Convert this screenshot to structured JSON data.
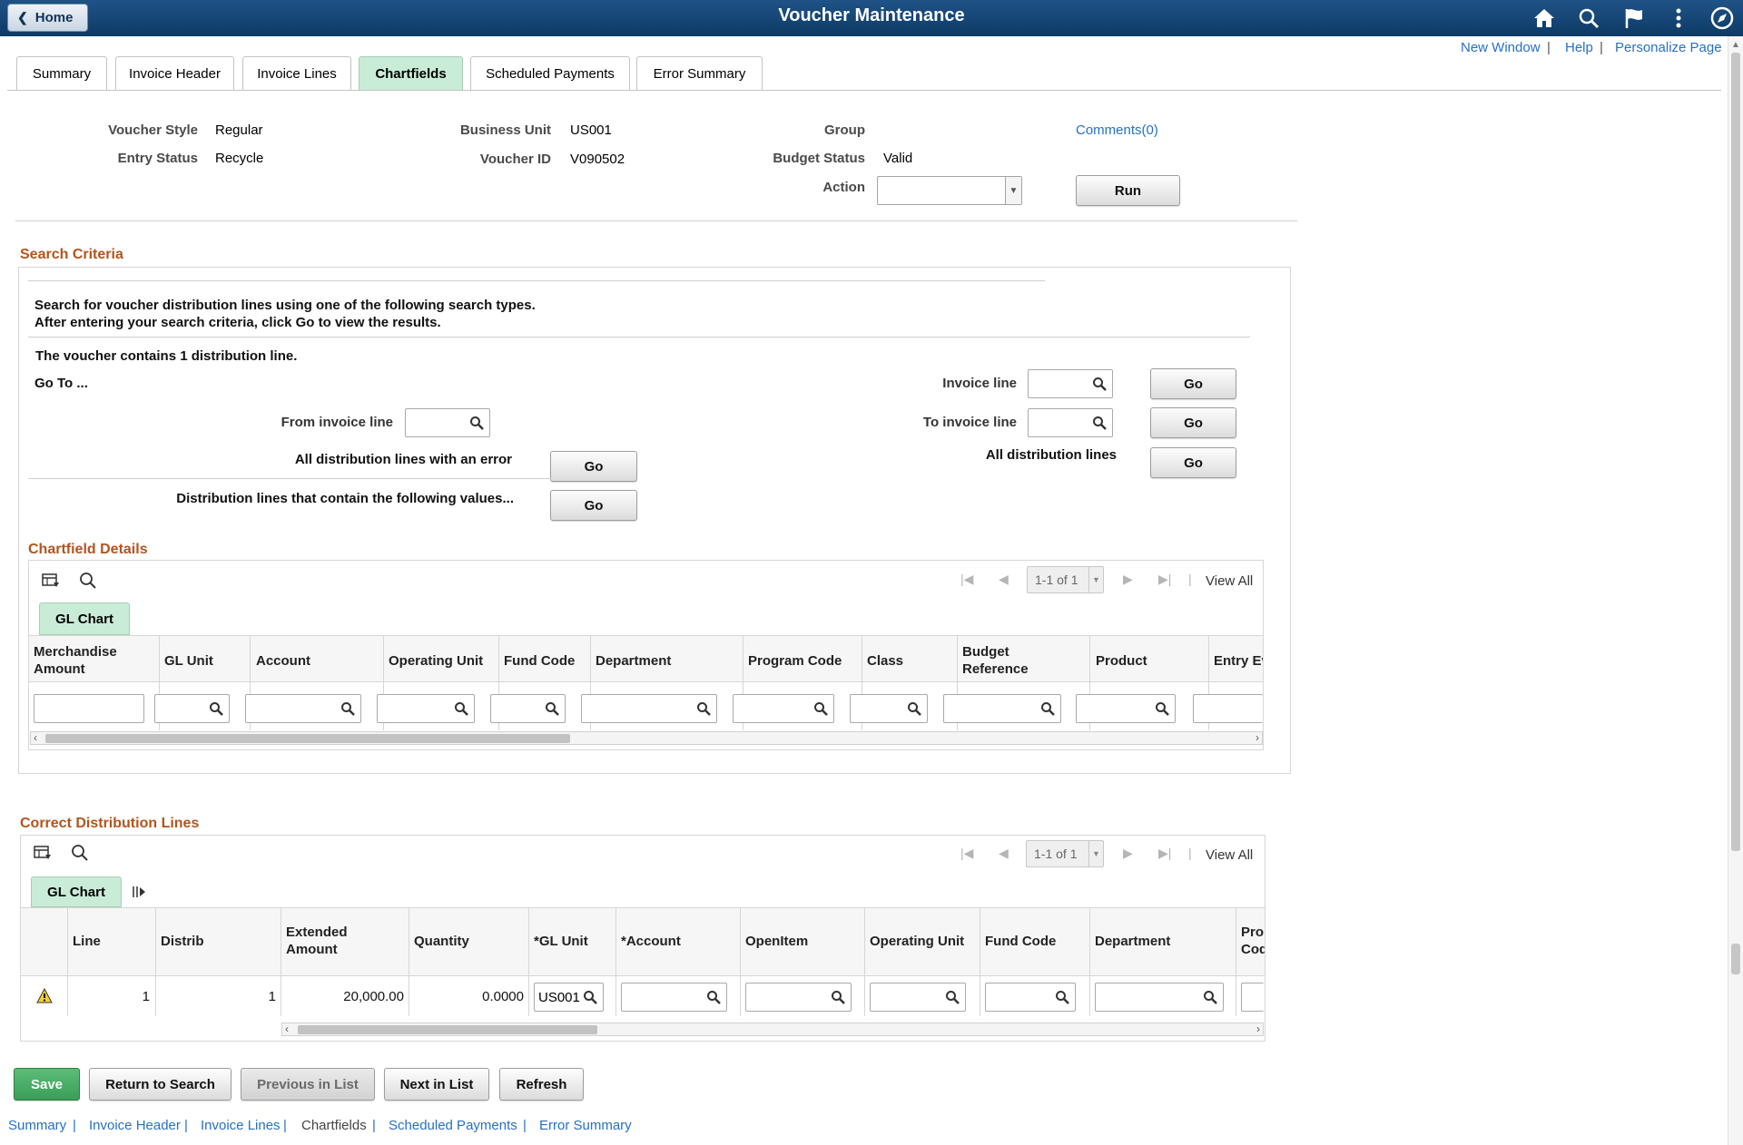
{
  "banner": {
    "home_label": "Home",
    "title": "Voucher Maintenance",
    "icons": [
      "home-icon",
      "search-icon",
      "flag-icon",
      "more-vertical-icon",
      "compass-icon"
    ]
  },
  "top_links": {
    "new_window": "New Window",
    "help": "Help",
    "personalize": "Personalize Page",
    "sep": "|"
  },
  "tabs": [
    "Summary",
    "Invoice Header",
    "Invoice Lines",
    "Chartfields",
    "Scheduled Payments",
    "Error Summary"
  ],
  "active_tab": "Chartfields",
  "header": {
    "voucher_style_label": "Voucher Style",
    "voucher_style": "Regular",
    "entry_status_label": "Entry Status",
    "entry_status": "Recycle",
    "business_unit_label": "Business Unit",
    "business_unit": "US001",
    "voucher_id_label": "Voucher ID",
    "voucher_id": "V090502",
    "group_label": "Group",
    "budget_status_label": "Budget Status",
    "budget_status": "Valid",
    "action_label": "Action",
    "action_value": "",
    "comments": "Comments(0)",
    "run_label": "Run"
  },
  "search": {
    "title": "Search Criteria",
    "instructions_1": "Search for voucher distribution lines using one of the following search types.",
    "instructions_2": "After entering your search criteria, click Go to view the results.",
    "contains": "The voucher contains 1 distribution line.",
    "goto": "Go To ...",
    "invoice_line": "Invoice line",
    "from_invoice_line": "From invoice line",
    "to_invoice_line": "To invoice line",
    "all_with_error": "All distribution lines with an error",
    "all_lines": "All distribution lines",
    "contain_values": "Distribution lines that contain the following values...",
    "go": "Go"
  },
  "chartfield_details": {
    "title": "Chartfield Details",
    "pager": "1-1 of 1",
    "view_all": "View All",
    "tab": "GL Chart",
    "columns": [
      "Merchandise Amount",
      "GL Unit",
      "Account",
      "Operating Unit",
      "Fund Code",
      "Department",
      "Program Code",
      "Class",
      "Budget Reference",
      "Product",
      "Entry Ev"
    ]
  },
  "correct_lines": {
    "title": "Correct Distribution Lines",
    "pager": "1-1 of 1",
    "view_all": "View All",
    "tab": "GL Chart",
    "columns": [
      "Line",
      "Distrib",
      "Extended Amount",
      "Quantity",
      "*GL Unit",
      "*Account",
      "OpenItem",
      "Operating Unit",
      "Fund Code",
      "Department",
      "Pro Cod"
    ],
    "row": {
      "line": "1",
      "distrib": "1",
      "extended_amount": "20,000.00",
      "quantity": "0.0000",
      "gl_unit": "US001"
    }
  },
  "buttons": {
    "save": "Save",
    "return_to_search": "Return to Search",
    "previous_in_list": "Previous in List",
    "next_in_list": "Next in List",
    "refresh": "Refresh"
  },
  "footer_links": [
    "Summary",
    "Invoice Header",
    "Invoice Lines",
    "Chartfields",
    "Scheduled Payments",
    "Error Summary"
  ],
  "colors": {
    "banner": "#0d3a66",
    "active_tab": "#c9ecd7",
    "link": "#2670c5",
    "section_title": "#b3541e",
    "save": "#3a9d58"
  }
}
